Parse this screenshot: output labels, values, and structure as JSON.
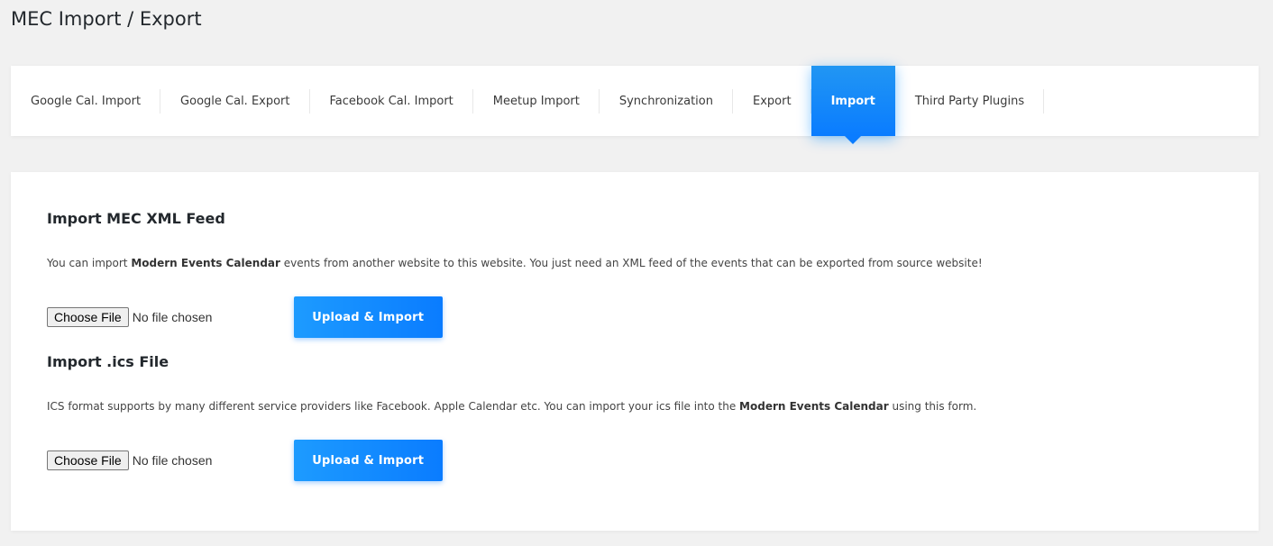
{
  "page": {
    "title": "MEC Import / Export"
  },
  "tabs": [
    {
      "label": "Google Cal. Import",
      "active": false
    },
    {
      "label": "Google Cal. Export",
      "active": false
    },
    {
      "label": "Facebook Cal. Import",
      "active": false
    },
    {
      "label": "Meetup Import",
      "active": false
    },
    {
      "label": "Synchronization",
      "active": false
    },
    {
      "label": "Export",
      "active": false
    },
    {
      "label": "Import",
      "active": true
    },
    {
      "label": "Third Party Plugins",
      "active": false
    }
  ],
  "xml_section": {
    "heading": "Import MEC XML Feed",
    "desc_before": "You can import ",
    "desc_bold": "Modern Events Calendar",
    "desc_after": " events from another website to this website. You just need an XML feed of the events that can be exported from source website!",
    "choose_label": "Choose File",
    "file_status": "No file chosen",
    "upload_label": "Upload & Import"
  },
  "ics_section": {
    "heading": "Import .ics File",
    "desc_before": "ICS format supports by many different service providers like Facebook. Apple Calendar etc. You can import your ics file into the ",
    "desc_bold": "Modern Events Calendar",
    "desc_after": " using this form.",
    "choose_label": "Choose File",
    "file_status": "No file chosen",
    "upload_label": "Upload & Import"
  },
  "colors": {
    "accent": "#0a7cff",
    "accent_light": "#1d9bff",
    "background": "#f1f1f1"
  }
}
